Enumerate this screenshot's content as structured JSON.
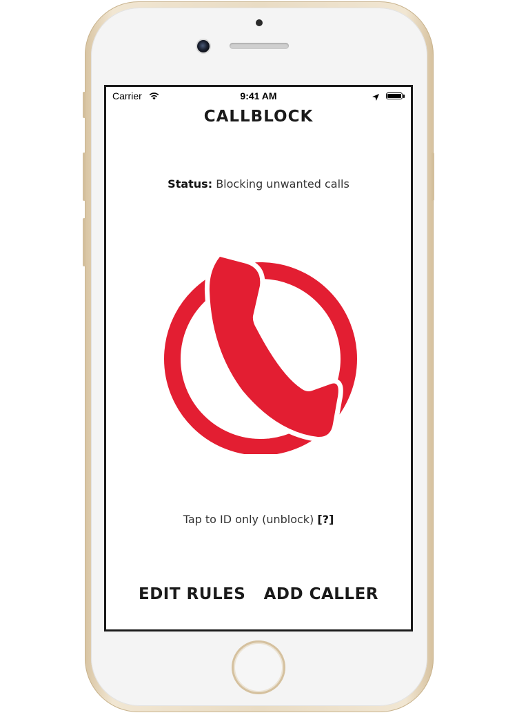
{
  "status_bar": {
    "carrier": "Carrier",
    "time": "9:41 AM",
    "battery_level_percent": 100
  },
  "app": {
    "title": "CALLBLOCK",
    "status_label": "Status:",
    "status_value": "Blocking unwanted calls",
    "logo_icon": "phone-handset-circle-icon",
    "tap_text": "Tap to ID only (unblock)",
    "help_link": "[?]"
  },
  "actions": {
    "edit_rules": "EDIT RULES",
    "add_caller": "ADD CALLER"
  },
  "colors": {
    "accent": "#e31e32",
    "text_dark": "#1a1a1a"
  }
}
